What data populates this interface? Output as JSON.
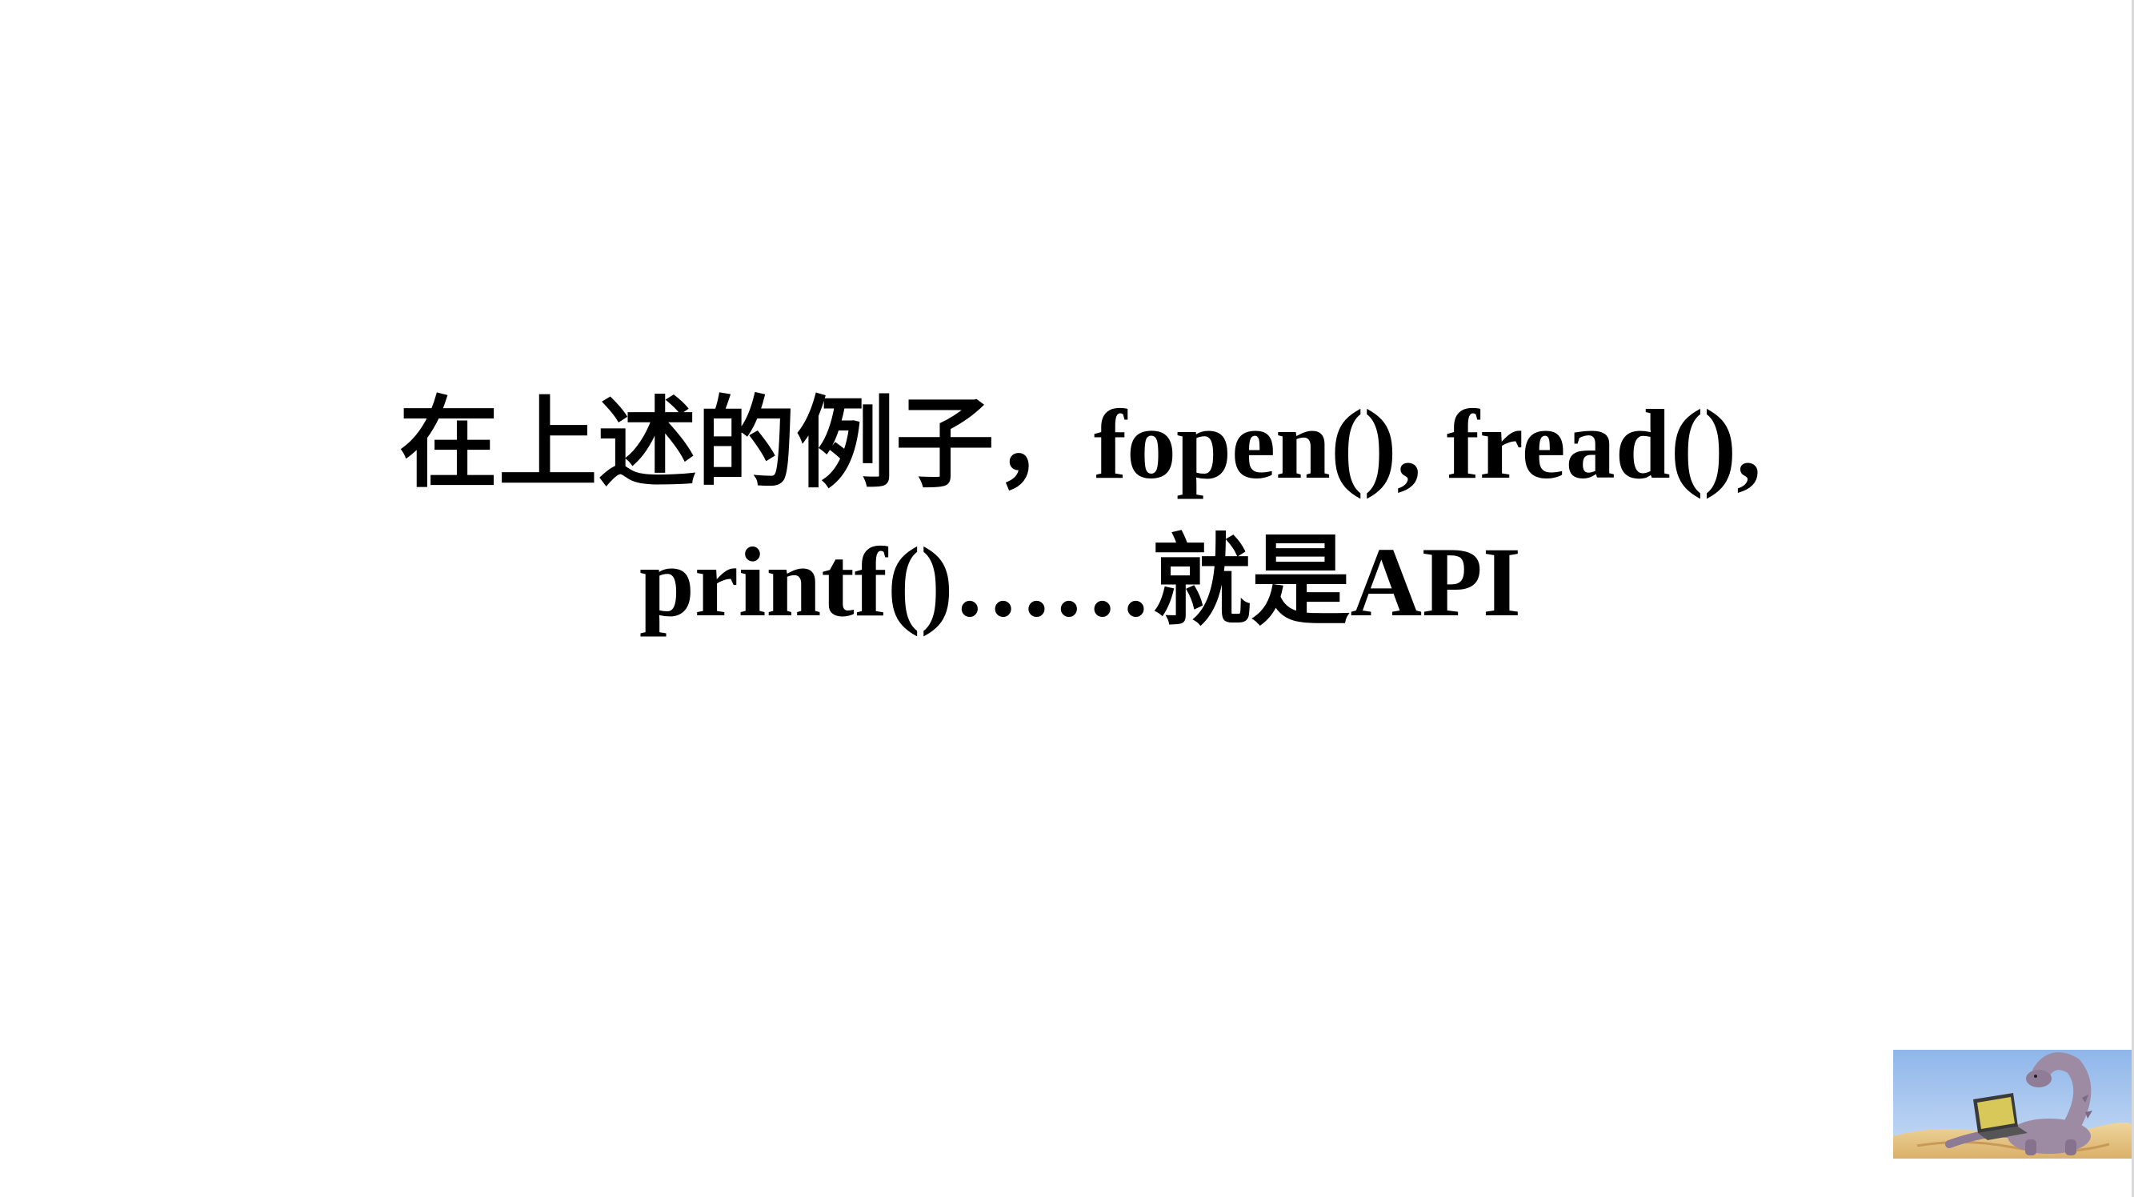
{
  "slide": {
    "body_lines": [
      "在上述的例子，fopen(), fread(),",
      "printf()……就是API"
    ]
  },
  "logo": {
    "icon": "dinosaur-with-laptop-icon"
  },
  "colors": {
    "background": "#ffffff",
    "text": "#000000",
    "sky": "#a9c8ef",
    "sand": "#e8c98a",
    "dinosaur": "#9d8aa3"
  }
}
